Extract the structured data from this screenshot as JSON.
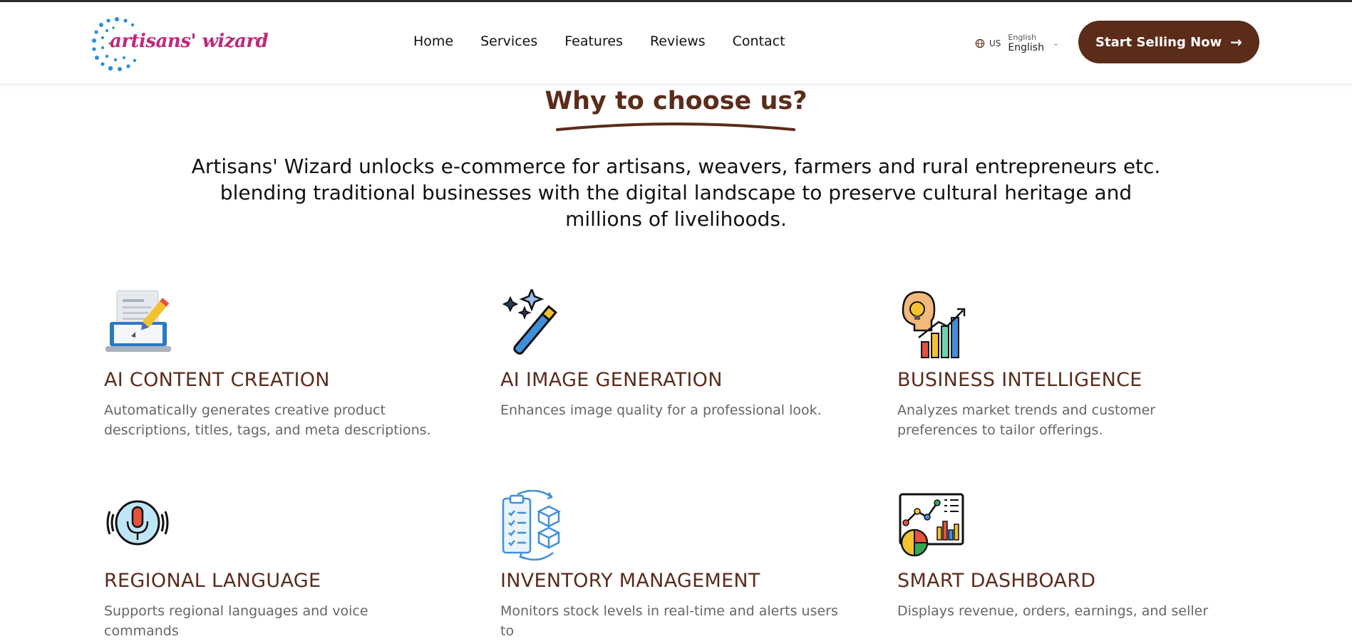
{
  "brand": {
    "name": "artisans' wizard",
    "dot_color": "#2a8fd6",
    "text_color": "#c0287a"
  },
  "nav": {
    "items": [
      "Home",
      "Services",
      "Features",
      "Reviews",
      "Contact"
    ]
  },
  "language": {
    "code": "US",
    "label_small": "English",
    "label": "English"
  },
  "cta": {
    "label": "Start Selling Now",
    "icon": "arrow-right-icon",
    "color": "#5b2c1a"
  },
  "section": {
    "title": "Why to choose us?",
    "intro_lines": [
      "Artisans' Wizard unlocks e-commerce for artisans, weavers, farmers and rural entrepreneurs etc.",
      "blending traditional businesses with the digital landscape to preserve cultural heritage and",
      "millions of livelihoods."
    ]
  },
  "features": [
    {
      "icon": "laptop-document-pencil-icon",
      "title": "AI CONTENT CREATION",
      "description": "Automatically generates creative product descriptions, titles, tags, and meta descriptions."
    },
    {
      "icon": "magic-wand-icon",
      "title": "AI IMAGE GENERATION",
      "description": "Enhances image quality for a professional look."
    },
    {
      "icon": "idea-head-growth-chart-icon",
      "title": "BUSINESS INTELLIGENCE",
      "description": "Analyzes market trends and customer preferences to tailor offerings."
    },
    {
      "icon": "microphone-voice-icon",
      "title": "REGIONAL LANGUAGE",
      "description": "Supports regional languages and voice commands"
    },
    {
      "icon": "clipboard-boxes-sync-icon",
      "title": "INVENTORY MANAGEMENT",
      "description": "Monitors stock levels in real-time and alerts users to"
    },
    {
      "icon": "dashboard-charts-icon",
      "title": "SMART DASHBOARD",
      "description": "Displays revenue, orders, earnings, and seller"
    }
  ]
}
